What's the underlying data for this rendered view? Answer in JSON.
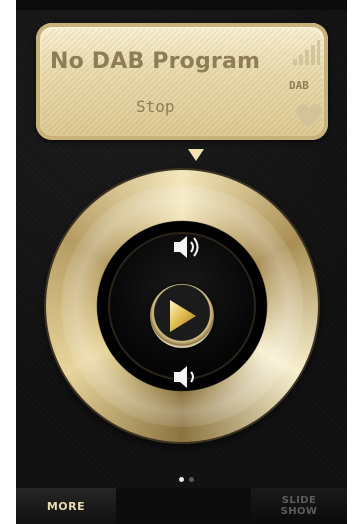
{
  "display": {
    "program_title": "No DAB Program",
    "status": "Stop",
    "band_label": "DAB",
    "signal_icon": "signal-bars-icon",
    "favorite_icon": "heart-icon"
  },
  "controls": {
    "volume_up_icon": "speaker-volume-up-icon",
    "play_icon": "play-icon",
    "volume_down_icon": "speaker-volume-down-icon"
  },
  "pager": {
    "page_count": 2,
    "current_page": 1
  },
  "bottom_bar": {
    "more_label": "MORE",
    "slideshow_label": "SLIDE SHOW"
  },
  "colors": {
    "gold_light": "#f4e7bc",
    "gold_dark": "#8c7440",
    "display_text": "#8e7d57",
    "background": "#121212"
  }
}
